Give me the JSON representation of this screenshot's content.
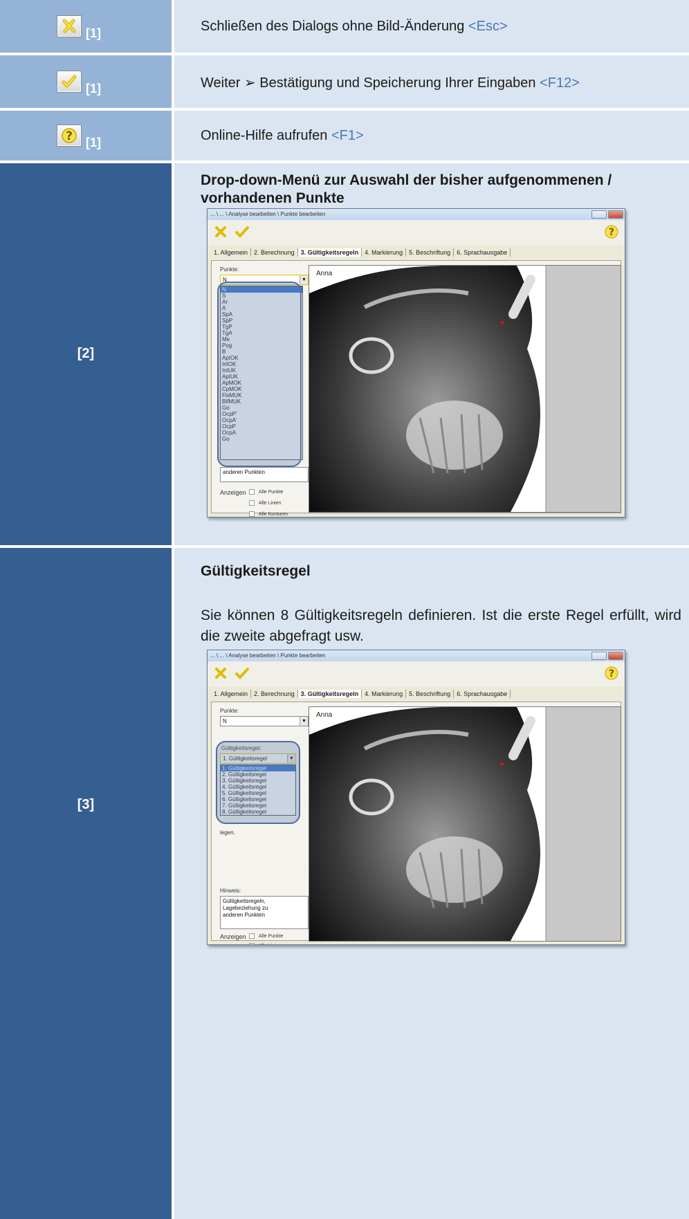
{
  "rows": [
    {
      "index": "[1]",
      "icon": "cancel-x-icon",
      "text": "Schließen des Dialogs ohne Bild-Änderung",
      "key": "<Esc>"
    },
    {
      "index": "[1]",
      "icon": "confirm-check-icon",
      "text": "Weiter ➢ Bestätigung und Speicherung Ihrer Eingaben",
      "key": "<F12>"
    },
    {
      "index": "[1]",
      "icon": "help-question-icon",
      "text": "Online-Hilfe aufrufen",
      "key": "<F1>"
    }
  ],
  "section2": {
    "index": "[2]",
    "heading_line1": "Drop-down-Menü zur Auswahl der bisher aufgenommenen /",
    "heading_line2": "vorhandenen Punkte"
  },
  "section3": {
    "index": "[3]",
    "heading": "Gültigkeitsregel",
    "paragraph": "Sie können 8 Gültigkeitsregeln definieren. Ist die erste Regel erfüllt, wird die zweite abgefragt usw."
  },
  "window": {
    "title": "... \\ ... \\ Analyse bearbeiten \\ Punkte bearbeiten",
    "tabs": [
      "1. Allgemein",
      "2. Berechnung",
      "3. Gültigkeitsregeln",
      "4. Markierung",
      "5. Beschriftung",
      "6. Sprachausgabe"
    ],
    "active_tab": "3. Gültigkeitsregeln",
    "points_label": "Punkte:",
    "points_value": "N",
    "patient_name": "Anna",
    "show_label": "Anzeigen",
    "checkboxes": [
      "Alle Punkte",
      "Alle Linien",
      "Alle Konturen"
    ]
  },
  "screenshot1": {
    "point_list": [
      "N",
      "S",
      "Ar",
      "A",
      "SpA",
      "SpP",
      "TgP",
      "TgA",
      "Me",
      "Pog",
      "B",
      "ApIOK",
      "InIOK",
      "InIUK",
      "ApIUK",
      "ApMOK",
      "CpMOK",
      "FisMUK",
      "BifMUK",
      "Go",
      "OcpP'",
      "OcpA'",
      "OcpP",
      "OcpA",
      "Go"
    ],
    "below_list_text": "anderen Punkten"
  },
  "screenshot2": {
    "rule_label": "Gültigkeitsregel:",
    "rule_value": "1. Gültigkeitsregel",
    "rule_list": [
      "1. Gültigkeitsregel",
      "2. Gültigkeitsregel",
      "3. Gültigkeitsregel",
      "4. Gültigkeitsregel",
      "5. Gültigkeitsregel",
      "6. Gültigkeitsregel",
      "7. Gültigkeitsregel",
      "8. Gültigkeitsregel"
    ],
    "behind_text": "legen.",
    "hint_label": "Hinweis:",
    "hint_lines": [
      "Gültigkeitsregeln,",
      "Lagebeziehung zu",
      "anderen Punkten"
    ]
  }
}
